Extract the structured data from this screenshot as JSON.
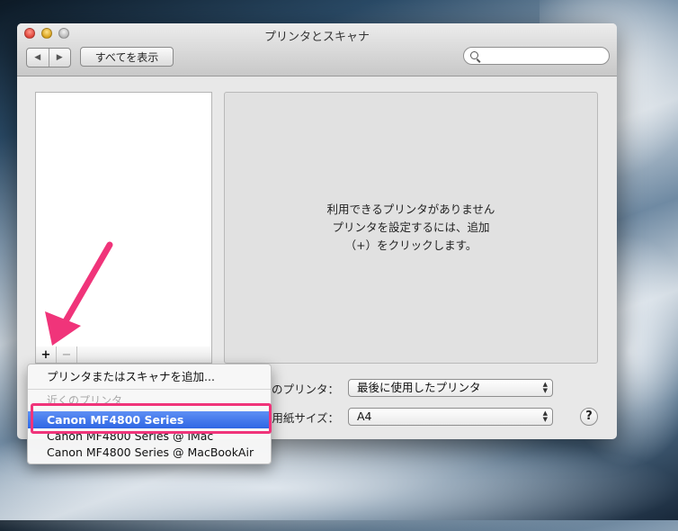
{
  "window": {
    "title": "プリンタとスキャナ",
    "show_all_label": "すべてを表示",
    "back_glyph": "◀",
    "forward_glyph": "▶"
  },
  "printer_list": {
    "add_glyph": "+",
    "remove_glyph": "−"
  },
  "main_panel": {
    "message_line1": "利用できるプリンタがありません",
    "message_line2": "プリンタを設定するには、追加",
    "message_line3": "（+）をクリックします。"
  },
  "settings": {
    "default_printer_label": "のプリンタ：",
    "default_printer_value": "最後に使用したプリンタ",
    "paper_size_label": "用紙サイズ：",
    "paper_size_value": "A4",
    "help_label": "?"
  },
  "add_menu": {
    "add_item": "プリンタまたはスキャナを追加...",
    "nearby_header": "近くのプリンタ",
    "items": [
      "Canon MF4800 Series",
      "Canon MF4800 Series @ iMac",
      "Canon MF4800 Series @ MacBookAir"
    ],
    "selected_index": 0
  },
  "annotation": {
    "color": "#f0347a"
  }
}
